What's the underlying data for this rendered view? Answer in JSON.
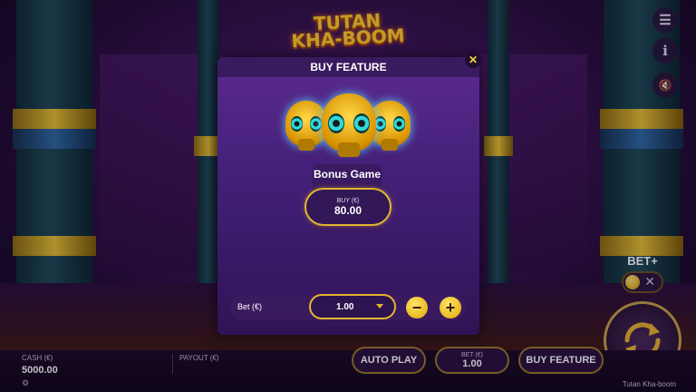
{
  "game": {
    "logo_line1": "TUTAN",
    "logo_line2": "KHA-BOOM",
    "name": "Tutan Kha-boom"
  },
  "side_buttons": {
    "menu_icon": "☰",
    "info_icon": "i",
    "sound_icon": "🔇"
  },
  "bet_plus": {
    "label": "BET+",
    "toggle_state": "off",
    "toggle_off_icon": "✕"
  },
  "bottom_bar": {
    "cash_label": "CASH (€)",
    "cash_value": "5000.00",
    "payout_label": "PAYOUT (€)",
    "autoplay_label": "AUTO PLAY",
    "bet_label": "BET (€)",
    "bet_value": "1.00",
    "buy_feature_label": "BUY FEATURE"
  },
  "modal": {
    "title": "BUY FEATURE",
    "close_icon": "✕",
    "feature_name": "Bonus Game",
    "buy_label": "BUY (€)",
    "buy_price": "80.00",
    "bet_row_label": "Bet (€)",
    "bet_value": "1.00",
    "minus_icon": "−",
    "plus_icon": "+"
  },
  "colors": {
    "accent_gold": "#e4b531",
    "panel_purple": "#45207a",
    "background": "#1a0a2e"
  }
}
